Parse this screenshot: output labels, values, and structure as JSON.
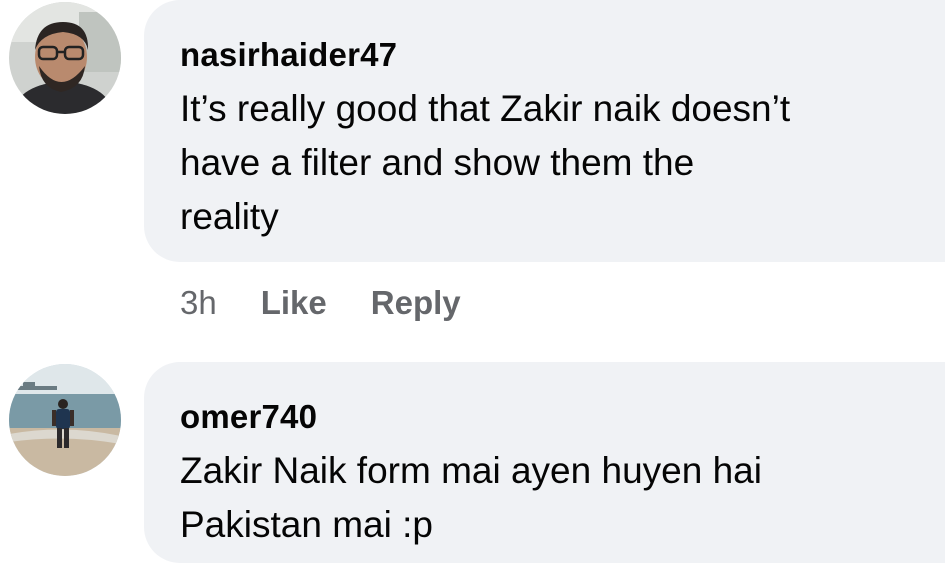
{
  "comments": [
    {
      "username": "nasirhaider47",
      "text": "It’s really good that Zakir naik doesn’t\nhave a filter and show them the\nreality",
      "time": "3h",
      "like_label": "Like",
      "reply_label": "Reply"
    },
    {
      "username": "omer740",
      "text": "Zakir Naik form mai ayen huyen hai\nPakistan mai :p"
    }
  ],
  "colors": {
    "bubble": "#f0f2f5",
    "text": "#050505",
    "meta": "#65676b"
  }
}
